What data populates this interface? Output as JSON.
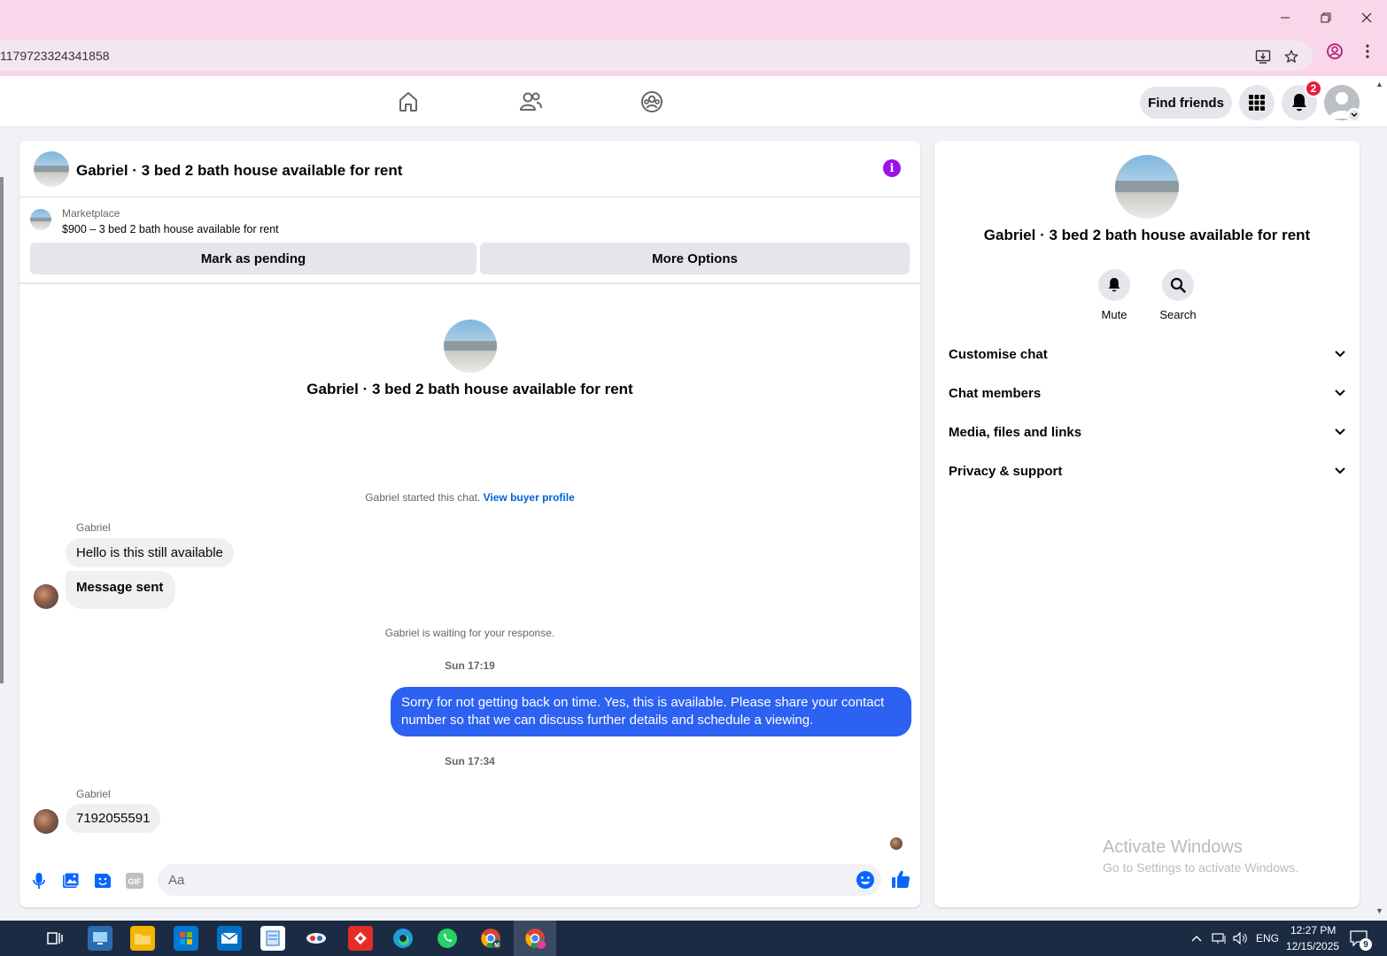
{
  "browser": {
    "url": "1179723324341858"
  },
  "nav": {
    "find_friends": "Find friends",
    "notification_count": "2"
  },
  "chat": {
    "title": "Gabriel · 3 bed 2 bath house available for rent",
    "marketplace_label": "Marketplace",
    "listing_text": "$900 – 3 bed 2 bath house available for rent",
    "mark_pending": "Mark as pending",
    "more_options": "More Options",
    "center_title": "Gabriel · 3 bed 2 bath house available for rent",
    "started_text": "Gabriel started this chat.",
    "view_buyer_profile": "View buyer profile",
    "messages": [
      {
        "sender": "Gabriel",
        "text": "Hello is this still available"
      },
      {
        "text": "Message sent"
      }
    ],
    "waiting_text": "Gabriel is waiting for your response.",
    "time1": "Sun 17:19",
    "outgoing_text": "Sorry for not getting back on time. Yes, this is available. Please share your contact number so that we can discuss further details and schedule a viewing.",
    "time2": "Sun 17:34",
    "reply_sender": "Gabriel",
    "reply_text": "7192055591",
    "composer_placeholder": "Aa"
  },
  "info_panel": {
    "title": "Gabriel · 3 bed 2 bath house available for rent",
    "mute_label": "Mute",
    "search_label": "Search",
    "sections": [
      "Customise chat",
      "Chat members",
      "Media, files and links",
      "Privacy & support"
    ]
  },
  "watermark": {
    "line1": "Activate Windows",
    "line2": "Go to Settings to activate Windows."
  },
  "taskbar": {
    "language": "ENG",
    "time": "12:27 PM",
    "date": "12/15/2025",
    "notif_count": "9"
  },
  "colors": {
    "messenger_blue": "#2c61f2",
    "info_purple": "#9b12e6",
    "link_blue": "#0064d1"
  }
}
